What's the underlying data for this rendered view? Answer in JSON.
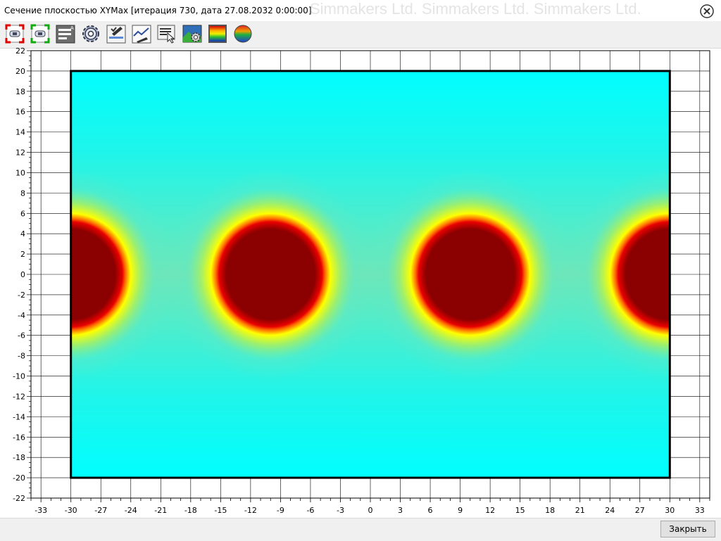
{
  "window": {
    "title": "Сечение плоскостью XYMax [итерация 730, дата 27.08.2032 0:00:00]",
    "watermark": "Simmakers Ltd. Simmakers Ltd.       Simmakers Ltd."
  },
  "toolbar": {
    "buttons": [
      {
        "name": "zoom-fit-red-icon"
      },
      {
        "name": "zoom-fit-green-icon"
      },
      {
        "name": "legend-icon"
      },
      {
        "name": "gear-icon"
      },
      {
        "name": "draw-settings-icon"
      },
      {
        "name": "chart-settings-icon"
      },
      {
        "name": "pointer-info-icon"
      },
      {
        "name": "image-settings-icon"
      },
      {
        "name": "palette-gradient-icon"
      },
      {
        "name": "color-ball-icon"
      }
    ]
  },
  "footer": {
    "close_label": "Закрыть"
  },
  "colors": {
    "background_field": "#00ffff",
    "mid_field": "#66e8c0",
    "ring_yellow": "#ffff00",
    "ring_red": "#ff1a00",
    "core": "#8b0000"
  },
  "chart_data": {
    "type": "heatmap",
    "xlim": [
      -34,
      34
    ],
    "ylim": [
      -22,
      22
    ],
    "domain_x": [
      -30,
      30
    ],
    "domain_y": [
      -20,
      20
    ],
    "x_ticks": [
      -33,
      -30,
      -27,
      -24,
      -21,
      -18,
      -15,
      -12,
      -9,
      -6,
      -3,
      0,
      3,
      6,
      9,
      12,
      15,
      18,
      21,
      24,
      27,
      30,
      33
    ],
    "y_ticks": [
      22,
      20,
      18,
      16,
      14,
      12,
      10,
      8,
      6,
      4,
      2,
      0,
      -2,
      -4,
      -6,
      -8,
      -10,
      -12,
      -14,
      -16,
      -18,
      -20,
      -22
    ],
    "x_labels": [
      "-33",
      "-30",
      "-27",
      "-24",
      "-21",
      "-18",
      "-15",
      "-12",
      "-9",
      "-6",
      "-3",
      "0",
      "3",
      "6",
      "9",
      "12",
      "15",
      "18",
      "21",
      "24",
      "27",
      "30",
      "33"
    ],
    "y_labels": [
      "22",
      "20",
      "18",
      "16",
      "14",
      "12",
      "10",
      "8",
      "6",
      "4",
      "2",
      "0",
      "-2",
      "-4",
      "-6",
      "-8",
      "-10",
      "-12",
      "-14",
      "-16",
      "-18",
      "-20",
      "-22"
    ],
    "hot_spots": [
      {
        "cx": -30,
        "cy": 0,
        "r": 6
      },
      {
        "cx": -10,
        "cy": 0,
        "r": 6
      },
      {
        "cx": 10,
        "cy": 0,
        "r": 6
      },
      {
        "cx": 30,
        "cy": 0,
        "r": 6
      }
    ],
    "grid": true
  }
}
